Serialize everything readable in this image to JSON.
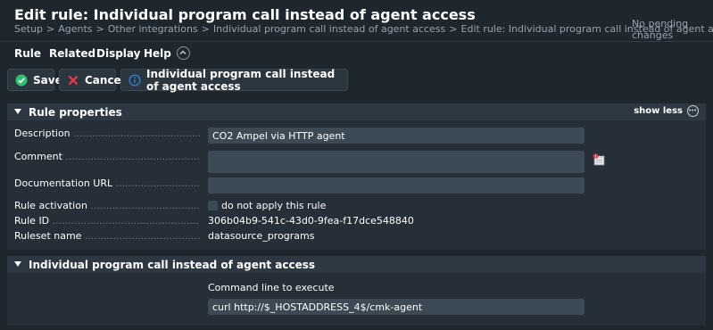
{
  "header": {
    "title": "Edit rule: Individual program call instead of agent access",
    "breadcrumb": [
      "Setup",
      "Agents",
      "Other integrations",
      "Individual program call instead of agent access",
      "Edit rule: Individual program call instead of agent access"
    ],
    "breadcrumb_separator": ">",
    "pending": "No pending changes"
  },
  "menu": {
    "items": [
      "Rule",
      "Related",
      "Display",
      "Help"
    ]
  },
  "toolbar": {
    "save_label": "Save",
    "cancel_label": "Cancel",
    "info_label": "Individual program call instead of agent access"
  },
  "rule_properties": {
    "title": "Rule properties",
    "show_less": "show less",
    "description_label": "Description",
    "description_value": "CO2 Ampel via HTTP agent",
    "comment_label": "Comment",
    "comment_value": "",
    "doc_url_label": "Documentation URL",
    "doc_url_value": "",
    "activation_label": "Rule activation",
    "activation_checkbox_label": "do not apply this rule",
    "rule_id_label": "Rule ID",
    "rule_id_value": "306b04b9-541c-43d0-9fea-f17dce548840",
    "ruleset_label": "Ruleset name",
    "ruleset_value": "datasource_programs"
  },
  "value_section": {
    "title": "Individual program call instead of agent access",
    "command_label": "Command line to execute",
    "command_value": "curl http://$_HOSTADDRESS_4$/cmk-agent"
  },
  "colors": {
    "background": "#1e262e",
    "section": "#262f38",
    "input": "#3b4a55",
    "save_green": "#2fbf71",
    "cancel_red": "#e2384f",
    "info_blue": "#2f7fd8"
  }
}
